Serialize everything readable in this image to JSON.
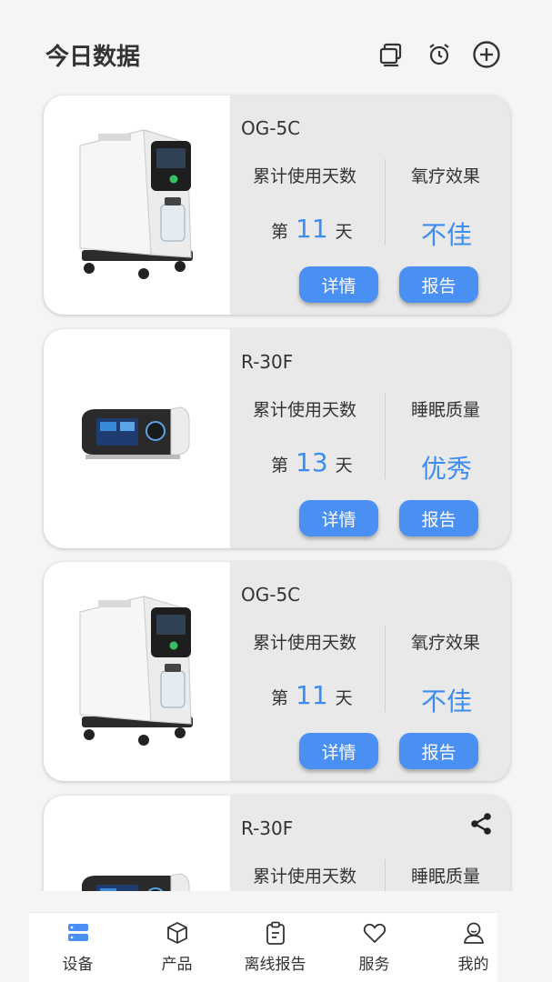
{
  "header": {
    "title": "今日数据",
    "icons": [
      "copy-icon",
      "alarm-clock-icon",
      "add-circle-icon"
    ]
  },
  "cards": [
    {
      "model": "OG-5C",
      "device_type": "oxygen-concentrator",
      "left_label": "累计使用天数",
      "right_label": "氧疗效果",
      "days_prefix": "第",
      "days_value": "11",
      "days_suffix": "天",
      "status": "不佳",
      "detail_label": "详情",
      "report_label": "报告"
    },
    {
      "model": "R-30F",
      "device_type": "ventilator",
      "left_label": "累计使用天数",
      "right_label": "睡眠质量",
      "days_prefix": "第",
      "days_value": "13",
      "days_suffix": "天",
      "status": "优秀",
      "detail_label": "详情",
      "report_label": "报告"
    },
    {
      "model": "OG-5C",
      "device_type": "oxygen-concentrator",
      "left_label": "累计使用天数",
      "right_label": "氧疗效果",
      "days_prefix": "第",
      "days_value": "11",
      "days_suffix": "天",
      "status": "不佳",
      "detail_label": "详情",
      "report_label": "报告"
    },
    {
      "model": "R-30F",
      "device_type": "ventilator",
      "left_label": "累计使用天数",
      "right_label": "睡眠质量",
      "share_icon": "share-icon"
    }
  ],
  "bottom_nav": [
    {
      "label": "设备",
      "icon": "device-icon",
      "active": true
    },
    {
      "label": "产品",
      "icon": "cube-icon",
      "active": false
    },
    {
      "label": "离线报告",
      "icon": "clipboard-icon",
      "active": false
    },
    {
      "label": "服务",
      "icon": "heart-icon",
      "active": false
    },
    {
      "label": "我的",
      "icon": "user-icon",
      "active": false
    }
  ],
  "colors": {
    "accent": "#3d8cf0",
    "button": "#4a8ff2",
    "card_bg": "#e9e9e9",
    "page_bg": "#f5f5f5"
  }
}
